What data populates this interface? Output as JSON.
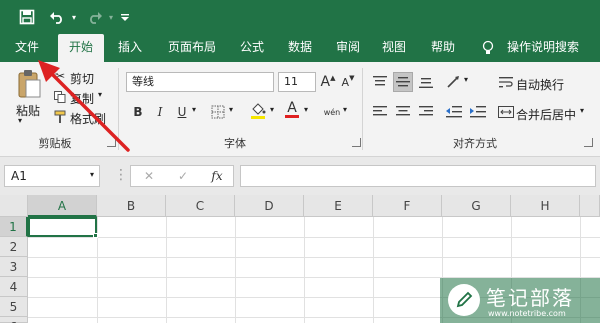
{
  "colors": {
    "brand": "#217346",
    "ribbon_bg": "#f3f3f3",
    "arrow": "#d22",
    "font_color_bar": "#e02020",
    "fill_color_bar": "#f5e600"
  },
  "quick_access": {
    "save_icon": "save-icon",
    "undo_icon": "undo-icon",
    "redo_icon": "redo-icon",
    "customize_icon": "customize-icon"
  },
  "tabs": [
    {
      "label": "文件"
    },
    {
      "label": "开始"
    },
    {
      "label": "插入"
    },
    {
      "label": "页面布局"
    },
    {
      "label": "公式"
    },
    {
      "label": "数据"
    },
    {
      "label": "审阅"
    },
    {
      "label": "视图"
    },
    {
      "label": "帮助"
    },
    {
      "label": "操作说明搜索"
    }
  ],
  "ribbon": {
    "clipboard": {
      "paste": "粘贴",
      "cut": "剪切",
      "copy": "复制",
      "format_painter": "格式刷",
      "group_label": "剪贴板"
    },
    "font": {
      "font_name": "等线",
      "font_size": "11",
      "bold": "B",
      "italic": "I",
      "underline": "U",
      "font_color": "A",
      "grow": "A",
      "shrink": "A",
      "phonetic": "wén",
      "group_label": "字体"
    },
    "alignment": {
      "wrap_text": "自动换行",
      "merge_center": "合并后居中",
      "group_label": "对齐方式"
    }
  },
  "formula_bar": {
    "name_box": "A1",
    "fx": "fx",
    "formula_value": ""
  },
  "sheet": {
    "columns": [
      "A",
      "B",
      "C",
      "D",
      "E",
      "F",
      "G",
      "H"
    ],
    "rows": [
      "1",
      "2",
      "3",
      "4",
      "5",
      "6"
    ],
    "active_cell": "A1"
  },
  "watermark": {
    "title": "笔记部落",
    "url": "www.notetribe.com"
  }
}
